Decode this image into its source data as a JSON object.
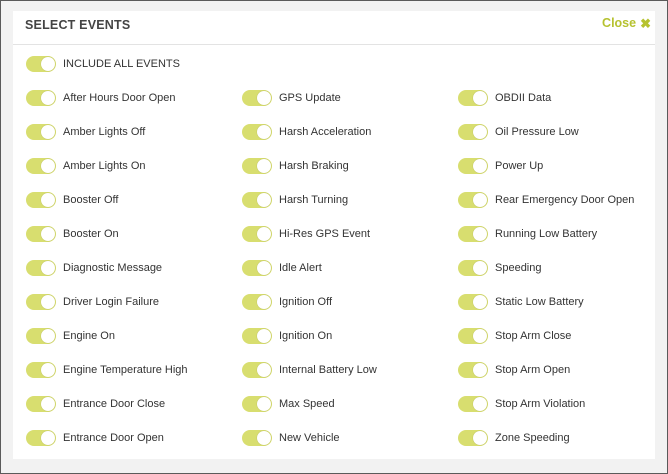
{
  "header": {
    "title": "SELECT EVENTS",
    "close_label": "Close",
    "close_icon": "✖"
  },
  "include_all": {
    "label": "INCLUDE ALL EVENTS",
    "on": true
  },
  "columns": [
    {
      "items": [
        {
          "label": "After Hours Door Open",
          "on": true
        },
        {
          "label": "Amber Lights Off",
          "on": true
        },
        {
          "label": "Amber Lights On",
          "on": true
        },
        {
          "label": "Booster Off",
          "on": true
        },
        {
          "label": "Booster On",
          "on": true
        },
        {
          "label": "Diagnostic Message",
          "on": true
        },
        {
          "label": "Driver Login Failure",
          "on": true
        },
        {
          "label": "Engine On",
          "on": true
        },
        {
          "label": "Engine Temperature High",
          "on": true
        },
        {
          "label": "Entrance Door Close",
          "on": true
        },
        {
          "label": "Entrance Door Open",
          "on": true
        }
      ]
    },
    {
      "items": [
        {
          "label": "GPS Update",
          "on": true
        },
        {
          "label": "Harsh Acceleration",
          "on": true
        },
        {
          "label": "Harsh Braking",
          "on": true
        },
        {
          "label": "Harsh Turning",
          "on": true
        },
        {
          "label": "Hi-Res GPS Event",
          "on": true
        },
        {
          "label": "Idle Alert",
          "on": true
        },
        {
          "label": "Ignition Off",
          "on": true
        },
        {
          "label": "Ignition On",
          "on": true
        },
        {
          "label": "Internal Battery Low",
          "on": true
        },
        {
          "label": "Max Speed",
          "on": true
        },
        {
          "label": "New Vehicle",
          "on": true
        }
      ]
    },
    {
      "items": [
        {
          "label": "OBDII Data",
          "on": true
        },
        {
          "label": "Oil Pressure Low",
          "on": true
        },
        {
          "label": "Power Up",
          "on": true
        },
        {
          "label": "Rear Emergency Door Open",
          "on": true
        },
        {
          "label": "Running Low Battery",
          "on": true
        },
        {
          "label": "Speeding",
          "on": true
        },
        {
          "label": "Static Low Battery",
          "on": true
        },
        {
          "label": "Stop Arm Close",
          "on": true
        },
        {
          "label": "Stop Arm Open",
          "on": true
        },
        {
          "label": "Stop Arm Violation",
          "on": true
        },
        {
          "label": "Zone Speeding",
          "on": true
        }
      ]
    }
  ],
  "colors": {
    "toggle_on": "#d8de6f",
    "accent": "#b6c230"
  }
}
